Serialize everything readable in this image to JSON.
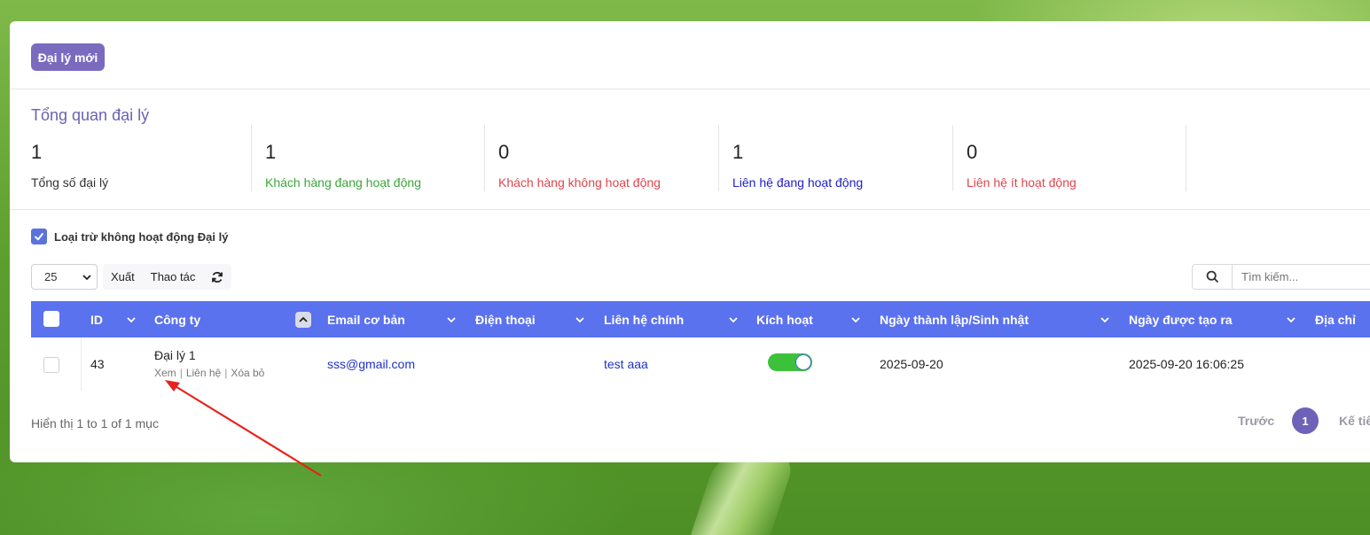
{
  "toolbar": {
    "new_agent_label": "Đại lý mới"
  },
  "overview": {
    "title": "Tổng quan đại lý",
    "stats": [
      {
        "value": "1",
        "label": "Tổng số đại lý",
        "color": "#333333"
      },
      {
        "value": "1",
        "label": "Khách hàng đang hoạt động",
        "color": "#3aa83a"
      },
      {
        "value": "0",
        "label": "Khách hàng không hoạt động",
        "color": "#e0454b"
      },
      {
        "value": "1",
        "label": "Liên hệ đang hoạt động",
        "color": "#1e1ec8"
      },
      {
        "value": "0",
        "label": "Liên hệ ít hoạt động",
        "color": "#e0454b"
      }
    ]
  },
  "filter": {
    "exclude_inactive_label": "Loại trừ không hoạt động Đại lý",
    "exclude_inactive_checked": true
  },
  "table_controls": {
    "page_size": "25",
    "export_label": "Xuất",
    "actions_label": "Thao tác",
    "search_placeholder": "Tìm kiếm..."
  },
  "table": {
    "columns": [
      "ID",
      "Công ty",
      "Email cơ bản",
      "Điện thoại",
      "Liên hệ chính",
      "Kích hoạt",
      "Ngày thành lập/Sinh nhật",
      "Ngày được tạo ra",
      "Địa chỉ"
    ],
    "rows": [
      {
        "id": "43",
        "company": "Đại lý 1",
        "actions": {
          "view": "Xem",
          "contact": "Liên hệ",
          "delete": "Xóa bỏ"
        },
        "email": "sss@gmail.com",
        "phone": "",
        "primary_contact": "test aaa",
        "active": true,
        "founded": "2025-09-20",
        "created": "2025-09-20 16:06:25",
        "address": ""
      }
    ]
  },
  "pagination": {
    "info": "Hiển thị 1 to 1 of 1 mục",
    "prev_label": "Trước",
    "current_page": "1",
    "next_label": "Kế tiếp"
  },
  "colors": {
    "accent": "#7b6bbf",
    "table_header": "#5b72ef",
    "toggle_on": "#3ec13a",
    "annotation_arrow": "#e8211b"
  }
}
